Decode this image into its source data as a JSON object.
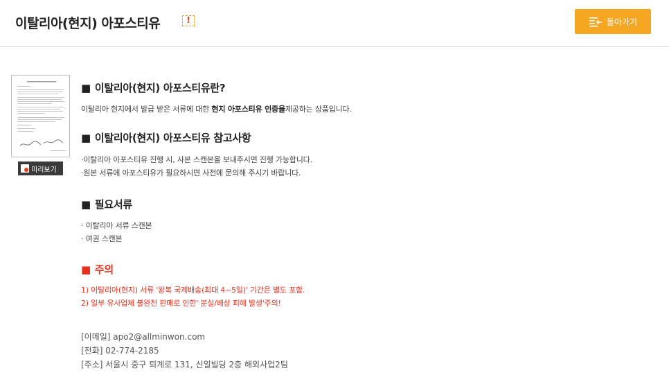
{
  "header": {
    "title": "이탈리아(현지) 아포스티유",
    "alert_icon_text": "!",
    "back_button_label": "돌아가기"
  },
  "thumbnail": {
    "preview_label": "미리보기"
  },
  "sections": {
    "what": {
      "heading": "이탈리아(현지) 아포스티유란?",
      "desc_prefix": "이탈리아 현지에서 발급 받은 서류에 대한 ",
      "desc_bold": "현지 아포스티유 인증을",
      "desc_suffix": "제공하는 상품입니다."
    },
    "notes": {
      "heading": "이탈리아(현지) 아포스티유 참고사항",
      "lines": [
        "·이탈리아 아포스티유 진행 시, 사본 스캔본을 보내주시면 진행 가능합니다.",
        "·원본 서류에 아포스티유가 필요하시면 사전에 문의해 주시기 바랍니다."
      ]
    },
    "docs": {
      "heading": "필요서류",
      "lines": [
        "· 이탈리아 서류 스캔본",
        "· 여권 스캔본"
      ]
    },
    "caution": {
      "heading": "주의",
      "lines": [
        "1) 이탈리아(현지) 서류 '왕복 국제배송(최대 4~5일)' 기간은 별도 포함.",
        "2) 일부 유사업체 불완전 판매로 인한' 분실/배상 피해 발생'주의!"
      ]
    }
  },
  "contact": {
    "email": "[이메일] apo2@allminwon.com",
    "phone": "[전화] 02-774-2185",
    "address": "[주소] 서울시 중구 퇴계로 131, 신일빌딩 2층 해외사업2팀"
  },
  "square_bullet": "■",
  "colors": {
    "accent": "#f5a623",
    "caution": "#e8301c"
  }
}
